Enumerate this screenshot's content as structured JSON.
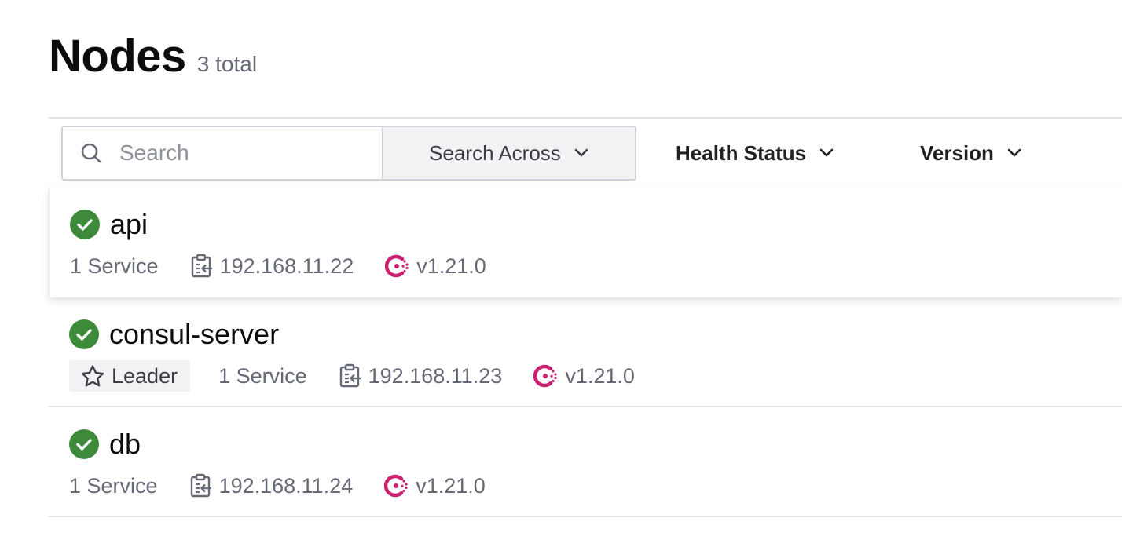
{
  "header": {
    "title": "Nodes",
    "count": "3 total"
  },
  "filters": {
    "search_placeholder": "Search",
    "search_across_label": "Search Across",
    "health_status_label": "Health Status",
    "version_label": "Version"
  },
  "nodes": [
    {
      "name": "api",
      "status": "passing",
      "services": "1 Service",
      "address": "192.168.11.22",
      "version": "v1.21.0"
    },
    {
      "name": "consul-server",
      "status": "passing",
      "leader_label": "Leader",
      "services": "1 Service",
      "address": "192.168.11.23",
      "version": "v1.21.0"
    },
    {
      "name": "db",
      "status": "passing",
      "services": "1 Service",
      "address": "192.168.11.24",
      "version": "v1.21.0"
    }
  ],
  "colors": {
    "passing": "#3c8a3a",
    "consul_brand": "#ca2171",
    "muted_text": "#656a76"
  },
  "icons": {
    "search": "search-icon",
    "chevron": "chevron-down-icon",
    "status": "check-circle-icon",
    "address": "clipboard-address-icon",
    "version": "consul-logo-icon",
    "leader": "star-icon"
  }
}
